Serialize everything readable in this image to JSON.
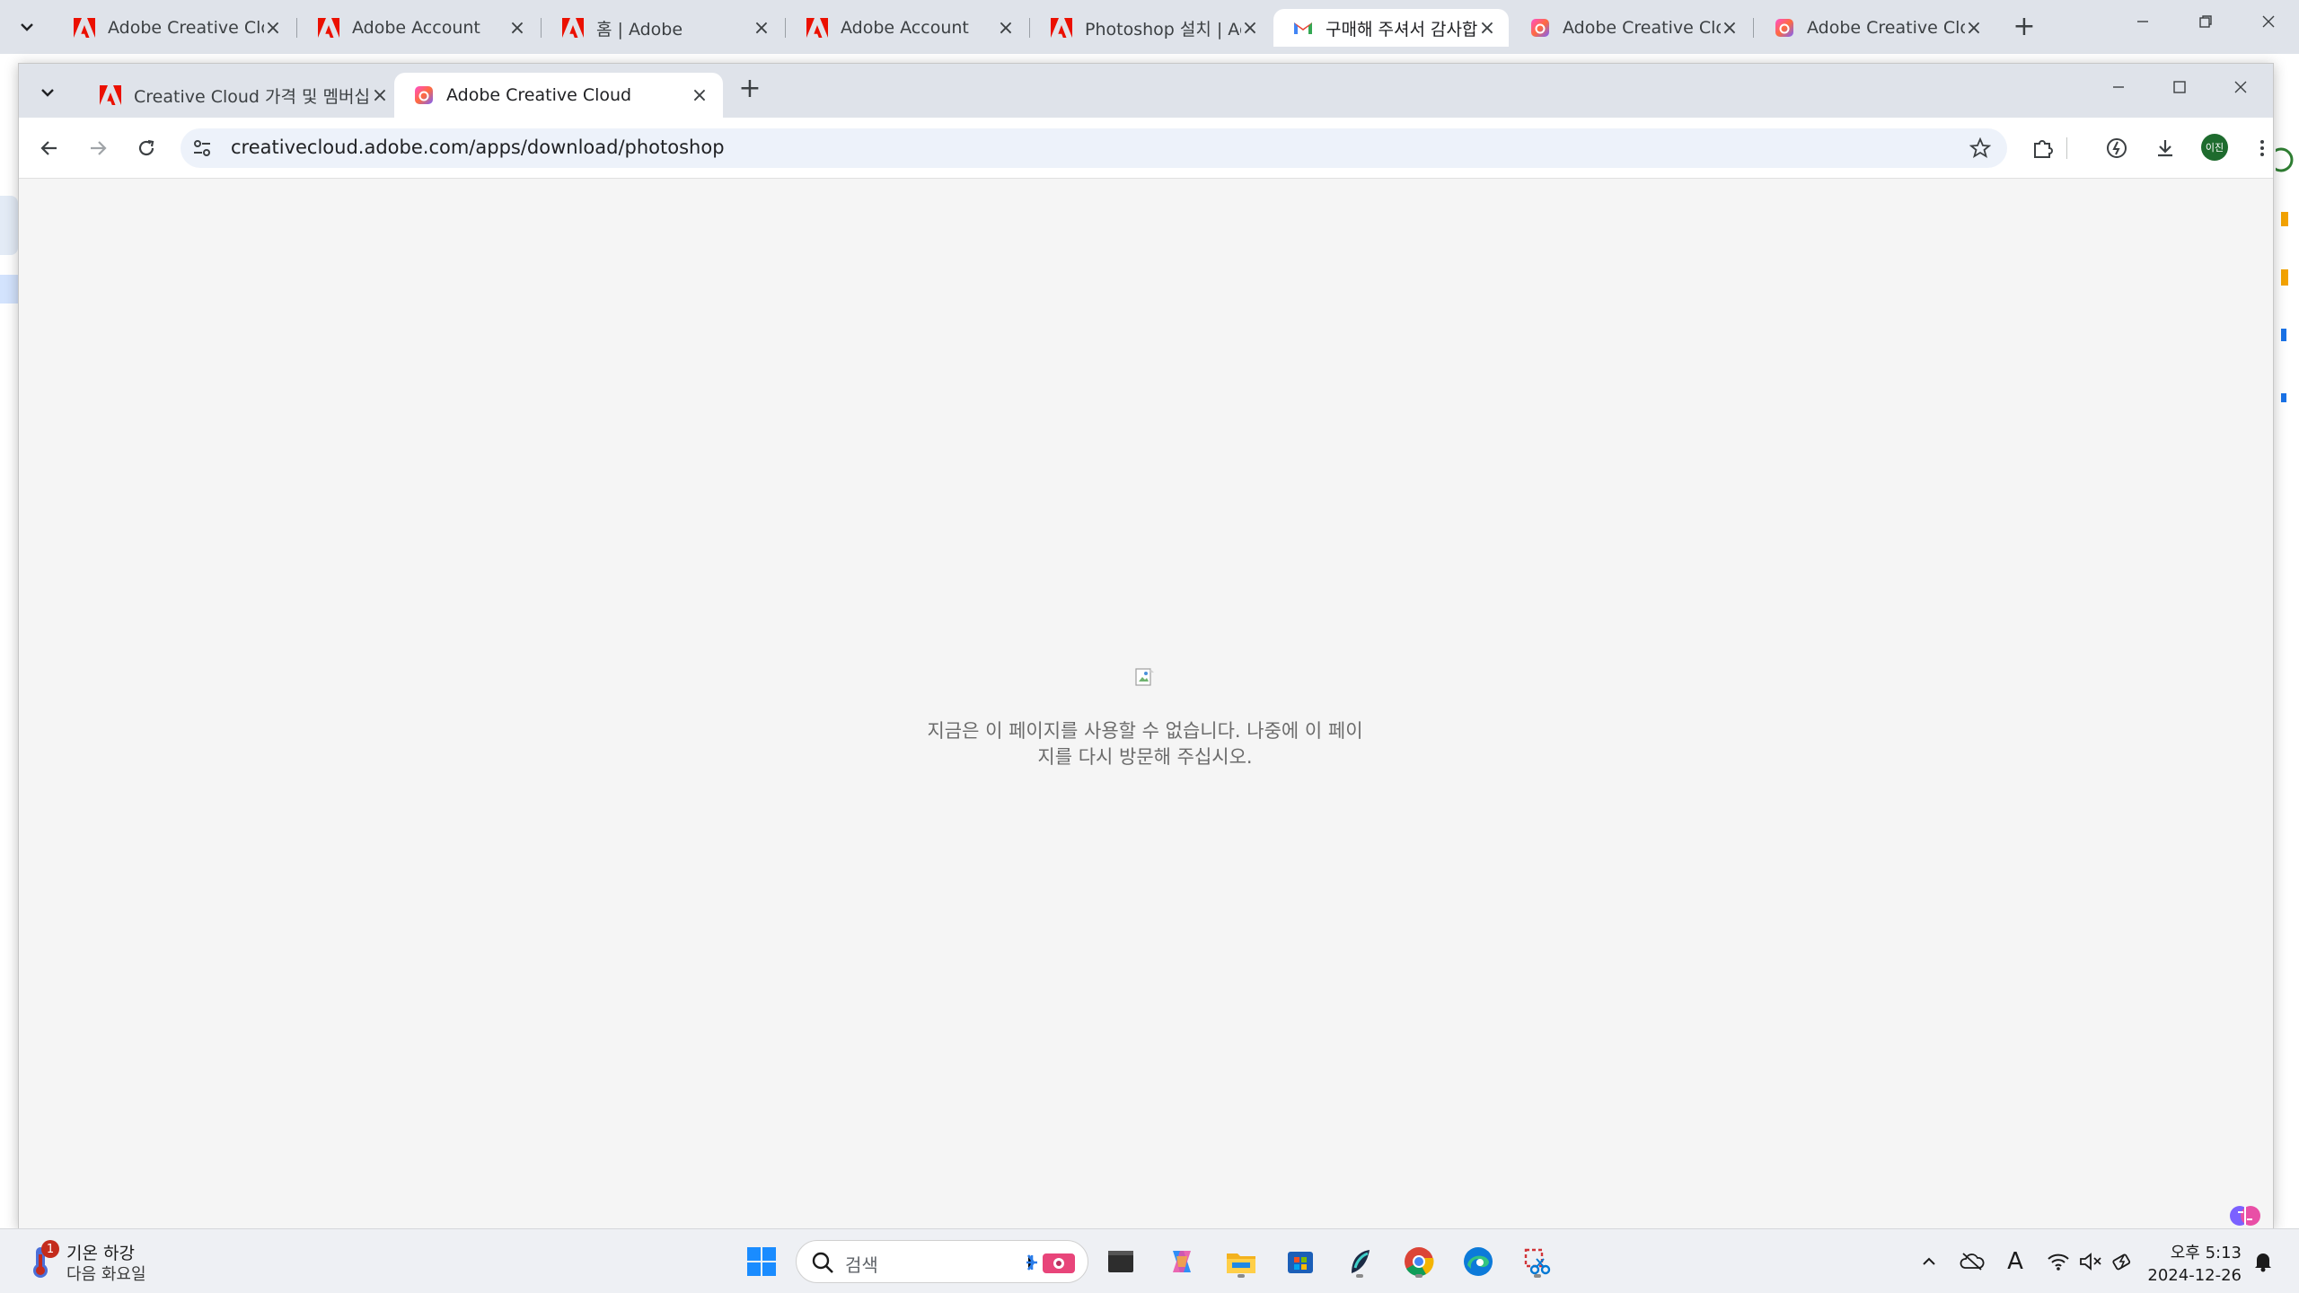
{
  "back_window": {
    "tabs": [
      {
        "title": "Adobe Creative Cloud",
        "icon": "adobe-icon",
        "active": false
      },
      {
        "title": "Adobe Account",
        "icon": "adobe-icon",
        "active": false
      },
      {
        "title": "홈 | Adobe",
        "icon": "adobe-icon",
        "active": false
      },
      {
        "title": "Adobe Account",
        "icon": "adobe-icon",
        "active": false
      },
      {
        "title": "Photoshop 설치 | Adobe",
        "icon": "adobe-icon",
        "active": false
      },
      {
        "title": "구매해 주셔서 감사합니다",
        "icon": "gmail-icon",
        "active": true
      },
      {
        "title": "Adobe Creative Cloud",
        "icon": "creative-cloud-icon",
        "active": false
      },
      {
        "title": "Adobe Creative Cloud",
        "icon": "creative-cloud-icon",
        "active": false
      }
    ],
    "new_tab_label": "+",
    "close_label": "×"
  },
  "front_window": {
    "tabs": [
      {
        "title": "Creative Cloud 가격 및 멤버십",
        "icon": "adobe-icon",
        "active": false
      },
      {
        "title": "Adobe Creative Cloud",
        "icon": "creative-cloud-icon",
        "active": true
      }
    ],
    "new_tab_label": "+",
    "close_label": "×",
    "address_bar": {
      "url": "creativecloud.adobe.com/apps/download/photoshop"
    },
    "profile_initials": "이진",
    "content": {
      "message": "지금은 이 페이지를 사용할 수 없습니다. 나중에 이 페이지를 다시 방문해 주십시오."
    }
  },
  "taskbar": {
    "weather": {
      "badge": "1",
      "title": "기온 하강",
      "subtitle": "다음 화요일"
    },
    "search_placeholder": "검색",
    "clock": {
      "time": "오후 5:13",
      "date": "2024-12-26"
    },
    "ime_indicator": "A"
  },
  "colors": {
    "adobe_red": "#eb1000",
    "tab_strip": "#dfe3ea",
    "omnibox": "#edf2fa",
    "page_bg": "#f5f5f5",
    "message_text": "#6b6b6b"
  }
}
